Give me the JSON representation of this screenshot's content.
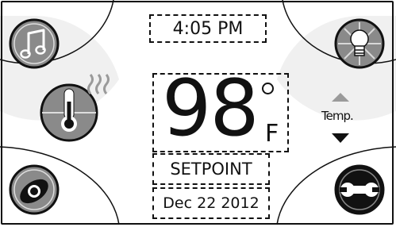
{
  "clock": {
    "time": "4:05 PM"
  },
  "temperature": {
    "value": "98",
    "unit": "F"
  },
  "mode": {
    "label": "SETPOINT"
  },
  "date": {
    "text": "Dec 22 2012"
  },
  "controls": {
    "temp_label": "Temp."
  },
  "icons": {
    "music": "music-note-icon",
    "heating": "thermometer-heat-icon",
    "camera": "eye-camera-icon",
    "light": "light-bulb-icon",
    "settings": "wrench-icon"
  },
  "colors": {
    "foreground": "#111111",
    "icon_fill": "#8a8a8a",
    "panel": "#f0f0f0"
  }
}
